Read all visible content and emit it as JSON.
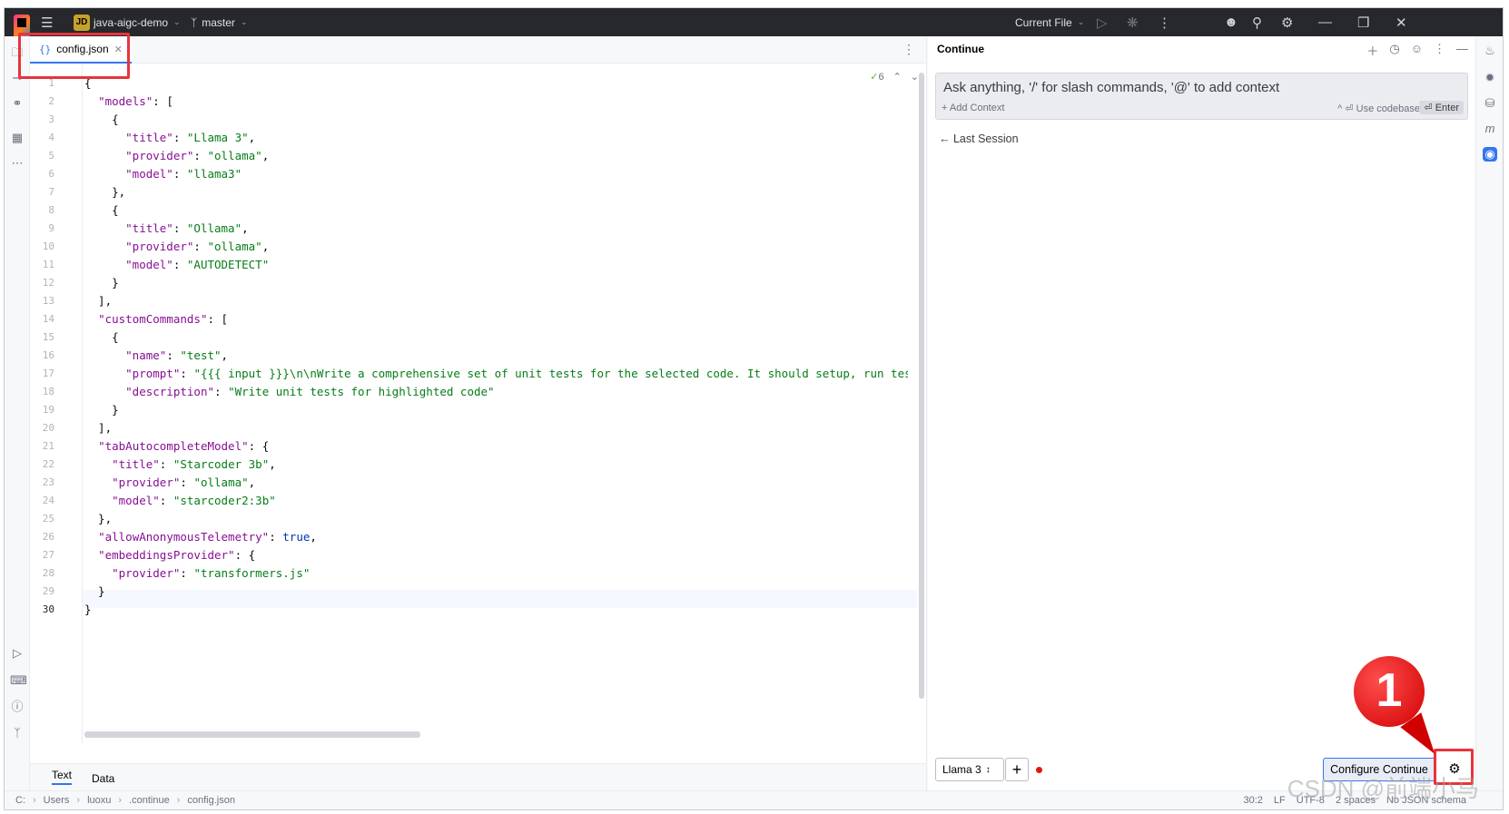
{
  "titlebar": {
    "project_badge": "JD",
    "project_name": "java-aigc-demo",
    "branch": "master",
    "run_config": "Current File"
  },
  "editor": {
    "tab_label": "config.json",
    "inspections_count": "6",
    "lines": [
      {
        "n": "1",
        "html": "{"
      },
      {
        "n": "2",
        "html": "  <span class='k'>\"models\"</span>: ["
      },
      {
        "n": "3",
        "html": "    {"
      },
      {
        "n": "4",
        "html": "      <span class='k'>\"title\"</span>: <span class='s'>\"Llama 3\"</span>,"
      },
      {
        "n": "5",
        "html": "      <span class='k'>\"provider\"</span>: <span class='s'>\"ollama\"</span>,"
      },
      {
        "n": "6",
        "html": "      <span class='k'>\"model\"</span>: <span class='s'>\"llama3\"</span>"
      },
      {
        "n": "7",
        "html": "    },"
      },
      {
        "n": "8",
        "html": "    {"
      },
      {
        "n": "9",
        "html": "      <span class='k'>\"title\"</span>: <span class='s'>\"Ollama\"</span>,"
      },
      {
        "n": "10",
        "html": "      <span class='k'>\"provider\"</span>: <span class='s'>\"ollama\"</span>,"
      },
      {
        "n": "11",
        "html": "      <span class='k'>\"model\"</span>: <span class='s'>\"AUTODETECT\"</span>"
      },
      {
        "n": "12",
        "html": "    }"
      },
      {
        "n": "13",
        "html": "  ],"
      },
      {
        "n": "14",
        "html": "  <span class='k'>\"customCommands\"</span>: ["
      },
      {
        "n": "15",
        "html": "    {"
      },
      {
        "n": "16",
        "html": "      <span class='k'>\"name\"</span>: <span class='s'>\"test\"</span>,"
      },
      {
        "n": "17",
        "html": "      <span class='k'>\"prompt\"</span>: <span class='s'>\"{{{ input }}}\\n\\nWrite a comprehensive set of unit tests for the selected code. It should setup, run tests that</span>"
      },
      {
        "n": "18",
        "html": "      <span class='k'>\"description\"</span>: <span class='s'>\"Write unit tests for highlighted code\"</span>"
      },
      {
        "n": "19",
        "html": "    }"
      },
      {
        "n": "20",
        "html": "  ],"
      },
      {
        "n": "21",
        "html": "  <span class='k'>\"tabAutocompleteModel\"</span>: {"
      },
      {
        "n": "22",
        "html": "    <span class='k'>\"title\"</span>: <span class='s'>\"Starcoder 3b\"</span>,"
      },
      {
        "n": "23",
        "html": "    <span class='k'>\"provider\"</span>: <span class='s'>\"ollama\"</span>,"
      },
      {
        "n": "24",
        "html": "    <span class='k'>\"model\"</span>: <span class='s'>\"starcoder2:3b\"</span>"
      },
      {
        "n": "25",
        "html": "  },"
      },
      {
        "n": "26",
        "html": "  <span class='k'>\"allowAnonymousTelemetry\"</span>: <span class='t'>true</span>,"
      },
      {
        "n": "27",
        "html": "  <span class='k'>\"embeddingsProvider\"</span>: {"
      },
      {
        "n": "28",
        "html": "    <span class='k'>\"provider\"</span>: <span class='s'>\"transformers.js\"</span>"
      },
      {
        "n": "29",
        "html": "  }"
      },
      {
        "n": "30",
        "html": "}"
      }
    ],
    "mode_tabs": [
      "Text",
      "Data"
    ]
  },
  "continue_panel": {
    "title": "Continue",
    "input_placeholder": "Ask anything, '/' for slash commands, '@' to add context",
    "add_context": "+ Add Context",
    "use_codebase": "^ ⏎ Use codebase",
    "enter": "⏎ Enter",
    "last_session": "← Last Session",
    "model": "Llama 3",
    "configure_button": "Configure Continue",
    "callout_number": "1"
  },
  "statusbar": {
    "breadcrumbs": [
      "C:",
      "Users",
      "luoxu",
      ".continue",
      "config.json"
    ],
    "position": "30:2",
    "line_sep": "LF",
    "encoding": "UTF-8",
    "indent": "2 spaces",
    "schema": "No JSON schema"
  },
  "watermark": "CSDN @前端小马",
  "colors": {
    "accent": "#3574f0",
    "highlight_red": "#e8343b",
    "json_key": "#871094",
    "json_string": "#067d17"
  }
}
